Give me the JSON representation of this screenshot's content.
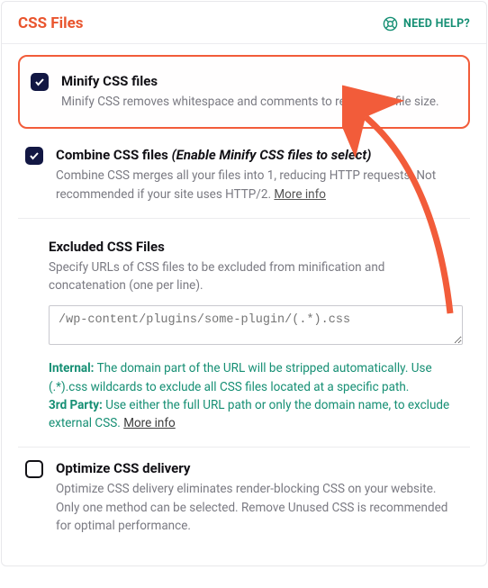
{
  "header": {
    "title": "CSS Files",
    "help_label": "NEED HELP?"
  },
  "options": {
    "minify": {
      "title": "Minify CSS files",
      "desc": "Minify CSS removes whitespace and comments to reduce the file size.",
      "checked": true
    },
    "combine": {
      "title": "Combine CSS files",
      "title_suffix": "(Enable Minify CSS files to select)",
      "desc": "Combine CSS merges all your files into 1, reducing HTTP requests. Not recommended if your site uses HTTP/2.",
      "more_info": "More info",
      "checked": true
    },
    "excluded": {
      "title": "Excluded CSS Files",
      "desc": "Specify URLs of CSS files to be excluded from minification and concatenation (one per line).",
      "placeholder": "/wp-content/plugins/some-plugin/(.*).css",
      "hint_internal_label": "Internal:",
      "hint_internal_text": "The domain part of the URL will be stripped automatically. Use (.*).css wildcards to exclude all CSS files located at a specific path.",
      "hint_3rdparty_label": "3rd Party:",
      "hint_3rdparty_text": "Use either the full URL path or only the domain name, to exclude external CSS.",
      "more_info": "More info"
    },
    "optimize": {
      "title": "Optimize CSS delivery",
      "desc": "Optimize CSS delivery eliminates render-blocking CSS on your website. Only one method can be selected. Remove Unused CSS is recommended for optimal performance.",
      "checked": false
    }
  }
}
